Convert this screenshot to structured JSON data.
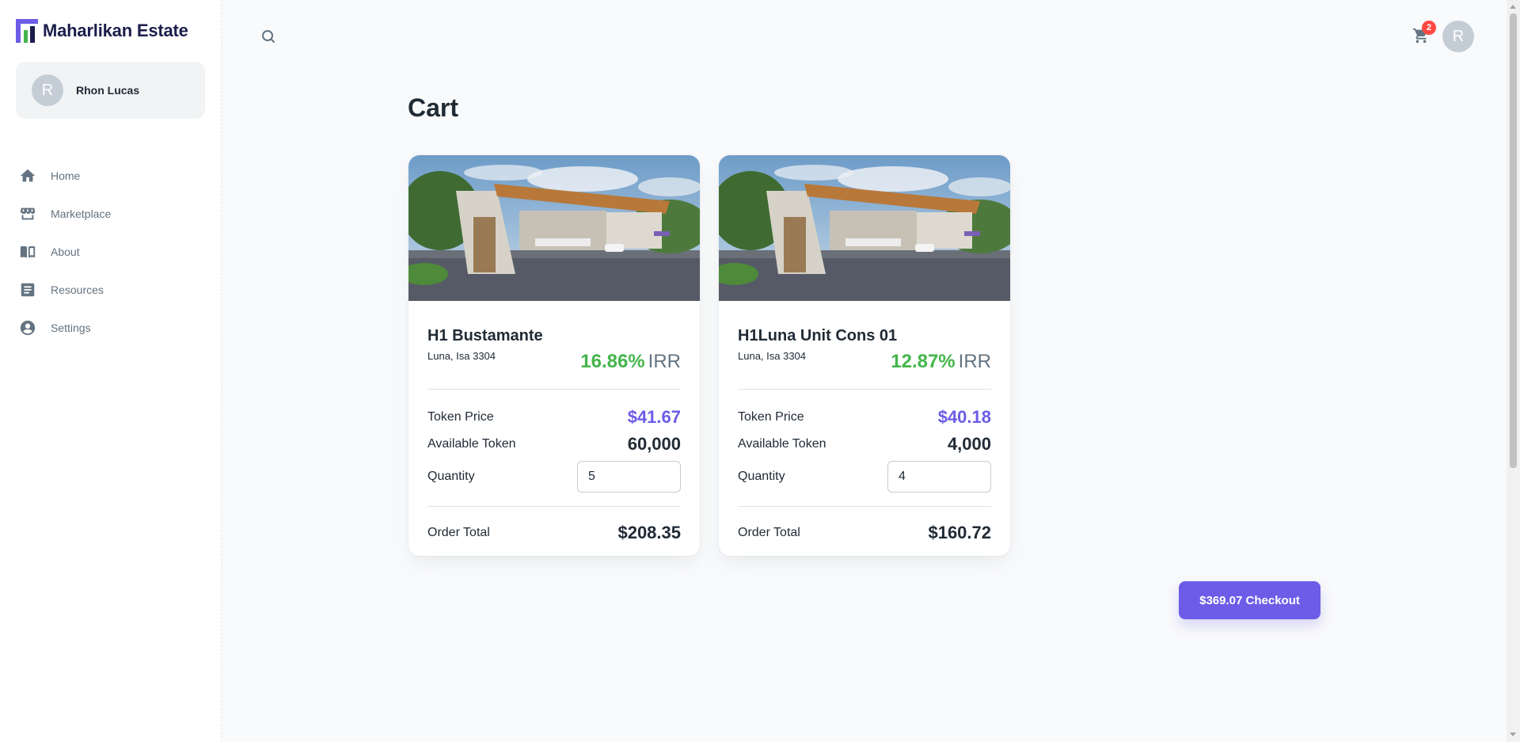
{
  "brand": {
    "name": "Maharlikan Estate",
    "logo_icon": "maharlikan-logo",
    "accent": "#6c5ce7"
  },
  "account": {
    "avatar_initial": "R",
    "name": "Rhon Lucas"
  },
  "nav": {
    "items": [
      {
        "label": "Home",
        "icon": "home-icon"
      },
      {
        "label": "Marketplace",
        "icon": "storefront-icon"
      },
      {
        "label": "About",
        "icon": "book-icon"
      },
      {
        "label": "Resources",
        "icon": "document-icon"
      },
      {
        "label": "Settings",
        "icon": "account-circle-icon"
      }
    ]
  },
  "topbar": {
    "search_icon": "search-icon",
    "cart_icon": "cart-icon",
    "cart_count": "2",
    "avatar_initial": "R"
  },
  "page": {
    "title": "Cart"
  },
  "cart": {
    "items": [
      {
        "name": "H1 Bustamante",
        "location": "Luna, Isa 3304",
        "irr_value": "16.86%",
        "irr_label": "IRR",
        "token_price_label": "Token Price",
        "token_price": "$41.67",
        "available_label": "Available Token",
        "available": "60,000",
        "quantity_label": "Quantity",
        "quantity": "5",
        "total_label": "Order Total",
        "total": "$208.35"
      },
      {
        "name": "H1Luna Unit Cons 01",
        "location": "Luna, Isa 3304",
        "irr_value": "12.87%",
        "irr_label": "IRR",
        "token_price_label": "Token Price",
        "token_price": "$40.18",
        "available_label": "Available Token",
        "available": "4,000",
        "quantity_label": "Quantity",
        "quantity": "4",
        "total_label": "Order Total",
        "total": "$160.72"
      }
    ],
    "checkout_label": "$369.07 Checkout"
  },
  "colors": {
    "irr_green": "#43b54a",
    "price_purple": "#6c5ce7",
    "badge_red": "#ff4842"
  }
}
